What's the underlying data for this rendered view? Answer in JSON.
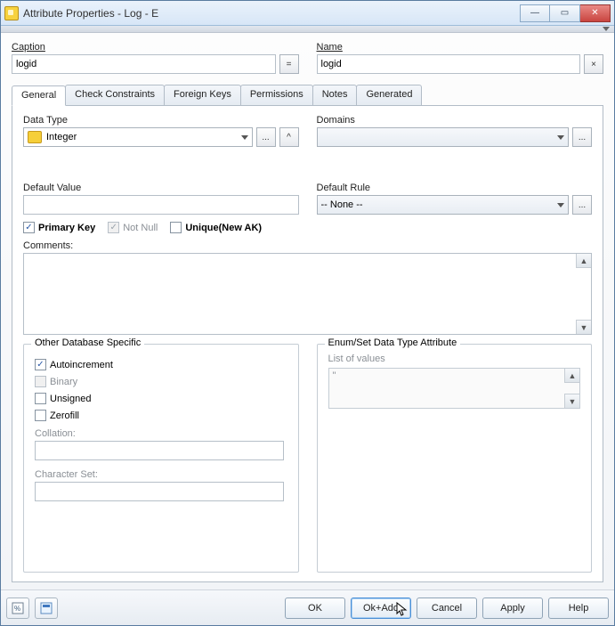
{
  "window": {
    "title": "Attribute Properties - Log - E"
  },
  "header": {
    "caption_label": "Caption",
    "caption_value": "logid",
    "equals_btn": "=",
    "name_label": "Name",
    "name_value": "logid",
    "name_sidebtn": "×"
  },
  "tabs": [
    "General",
    "Check Constraints",
    "Foreign Keys",
    "Permissions",
    "Notes",
    "Generated"
  ],
  "active_tab": 0,
  "general": {
    "datatype_label": "Data Type",
    "datatype_value": "Integer",
    "dt_btn1": "...",
    "dt_btn2": "^",
    "domains_label": "Domains",
    "domains_value": "",
    "domains_btn": "...",
    "default_value_label": "Default Value",
    "default_value": "",
    "default_rule_label": "Default Rule",
    "default_rule_value": "-- None --",
    "default_rule_btn": "...",
    "pk_label": "Primary Key",
    "nn_label": "Not Null",
    "unique_label": "Unique(New AK)",
    "comments_label": "Comments:",
    "comments_value": ""
  },
  "other": {
    "legend": "Other Database Specific",
    "autoincrement": "Autoincrement",
    "binary": "Binary",
    "unsigned": "Unsigned",
    "zerofill": "Zerofill",
    "collation_label": "Collation:",
    "collation_value": "",
    "charset_label": "Character Set:",
    "charset_value": ""
  },
  "enumset": {
    "legend": "Enum/Set Data Type Attribute",
    "list_label": "List of values",
    "first_item": "\""
  },
  "footer": {
    "ok": "OK",
    "okadd": "Ok+Add",
    "cancel": "Cancel",
    "apply": "Apply",
    "help": "Help"
  }
}
